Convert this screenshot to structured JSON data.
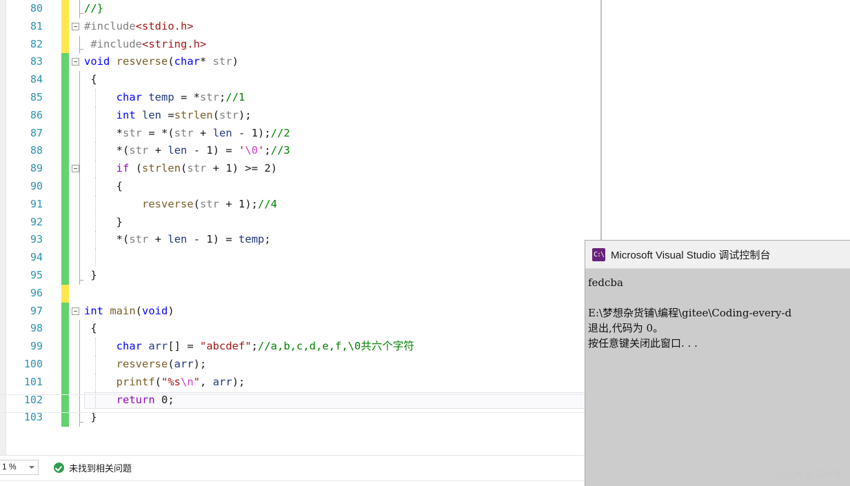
{
  "editor": {
    "gutter_first_line": 80,
    "current_line": 102,
    "lines": [
      {
        "num": "80",
        "change": "yellow",
        "collapse": false,
        "indent_guide": false,
        "vguide": "cap"
      },
      {
        "num": "81",
        "change": "yellow",
        "collapse": true,
        "indent_guide": false,
        "vguide": "none"
      },
      {
        "num": "82",
        "change": "yellow",
        "collapse": false,
        "indent_guide": false,
        "vguide": "cap"
      },
      {
        "num": "83",
        "change": "green",
        "collapse": true,
        "indent_guide": false,
        "vguide": "none"
      },
      {
        "num": "84",
        "change": "green",
        "collapse": false,
        "indent_guide": false,
        "vguide": "line"
      },
      {
        "num": "85",
        "change": "green",
        "collapse": false,
        "indent_guide": true,
        "vguide": "line"
      },
      {
        "num": "86",
        "change": "green",
        "collapse": false,
        "indent_guide": true,
        "vguide": "line"
      },
      {
        "num": "87",
        "change": "green",
        "collapse": false,
        "indent_guide": true,
        "vguide": "line"
      },
      {
        "num": "88",
        "change": "green",
        "collapse": false,
        "indent_guide": true,
        "vguide": "line"
      },
      {
        "num": "89",
        "change": "green",
        "collapse": true,
        "indent_guide": true,
        "vguide": "line"
      },
      {
        "num": "90",
        "change": "green",
        "collapse": false,
        "indent_guide": true,
        "vguide": "line"
      },
      {
        "num": "91",
        "change": "green",
        "collapse": false,
        "indent_guide": true,
        "vguide": "line"
      },
      {
        "num": "92",
        "change": "green",
        "collapse": false,
        "indent_guide": true,
        "vguide": "line"
      },
      {
        "num": "93",
        "change": "green",
        "collapse": false,
        "indent_guide": true,
        "vguide": "line"
      },
      {
        "num": "94",
        "change": "green",
        "collapse": false,
        "indent_guide": true,
        "vguide": "line"
      },
      {
        "num": "95",
        "change": "green",
        "collapse": false,
        "indent_guide": false,
        "vguide": "cap"
      },
      {
        "num": "96",
        "change": "yellow",
        "collapse": false,
        "indent_guide": false,
        "vguide": "none"
      },
      {
        "num": "97",
        "change": "green",
        "collapse": true,
        "indent_guide": false,
        "vguide": "none"
      },
      {
        "num": "98",
        "change": "green",
        "collapse": false,
        "indent_guide": false,
        "vguide": "line"
      },
      {
        "num": "99",
        "change": "green",
        "collapse": false,
        "indent_guide": true,
        "vguide": "line"
      },
      {
        "num": "100",
        "change": "green",
        "collapse": false,
        "indent_guide": true,
        "vguide": "line"
      },
      {
        "num": "101",
        "change": "green",
        "collapse": false,
        "indent_guide": true,
        "vguide": "line"
      },
      {
        "num": "102",
        "change": "green",
        "collapse": false,
        "indent_guide": true,
        "vguide": "line"
      },
      {
        "num": "103",
        "change": "green",
        "collapse": false,
        "indent_guide": false,
        "vguide": "cap"
      }
    ],
    "code_text": [
      "//}",
      "#include<stdio.h>",
      "#include<string.h>",
      "void resverse(char* str)",
      "{",
      "    char temp = *str;//1",
      "    int len =strlen(str);",
      "    *str = *(str + len - 1);//2",
      "    *(str + len - 1) = '\\0';//3",
      "    if (strlen(str + 1) >= 2)",
      "    {",
      "        resverse(str + 1);//4",
      "    }",
      "    *(str + len - 1) = temp;",
      "",
      "}",
      "",
      "int main(void)",
      "{",
      "    char arr[] = \"abcdef\";//a,b,c,d,e,f,\\0共六个字符",
      "    resverse(arr);",
      "    printf(\"%s\\n\", arr);",
      "    return 0;",
      "}"
    ]
  },
  "statusbar": {
    "zoom_value": "1 %",
    "error_summary": "未找到相关问题",
    "ok_icon": "check-circle-icon"
  },
  "console": {
    "icon": "console-app-icon",
    "icon_glyph": "C:\\",
    "title": "Microsoft Visual Studio 调试控制台",
    "output_lines": [
      "fedcba",
      "",
      "E:\\梦想杂货铺\\编程\\gitee\\Coding-every-d",
      "退出,代码为 0。",
      "按任意键关闭此窗口. . ."
    ]
  },
  "watermark": {
    "text": "CSDN @云小逸"
  },
  "colors": {
    "change_green": "#64d26f",
    "change_yellow": "#ffe84d",
    "line_number": "#2b91af",
    "keyword": "#0000ff",
    "control_keyword": "#8f08c4",
    "function": "#795e26",
    "parameter": "#808080",
    "local_var": "#1f377f",
    "string": "#a31515",
    "escape": "#cf40cf",
    "comment": "#008000",
    "console_bg": "#cccccc",
    "console_title_bg": "#f0f0f0",
    "vs_purple": "#68217a"
  }
}
